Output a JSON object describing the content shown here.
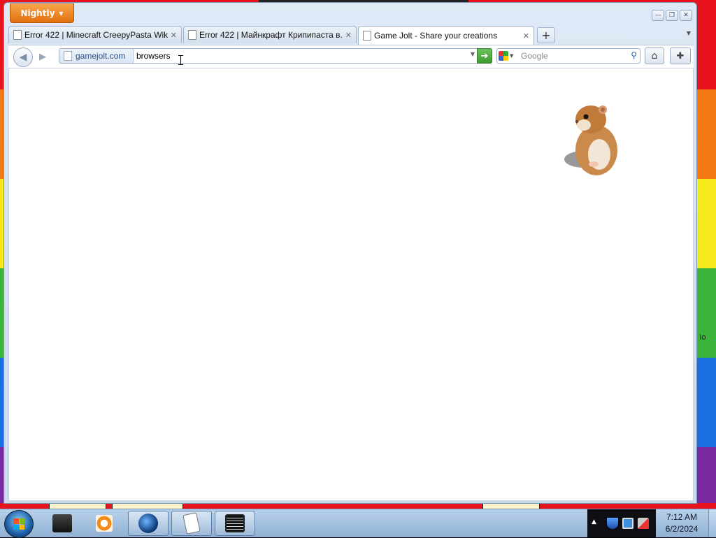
{
  "app": {
    "menu_button_label": "Nightly"
  },
  "window_controls": {
    "minimize": "—",
    "restore": "❐",
    "close": "✕"
  },
  "tabs": [
    {
      "title": "Error 422 | Minecraft CreepyPasta Wik...",
      "active": false
    },
    {
      "title": "Error 422 | Майнкрафт Крипипаста в...",
      "active": false
    },
    {
      "title": "Game Jolt - Share your creations",
      "active": true
    }
  ],
  "tab_close_glyph": "✕",
  "new_tab_glyph": "+",
  "toolbar": {
    "back_glyph": "◀",
    "forward_glyph": "▶",
    "site_identity": "gamejolt.com",
    "url_value": "browsers",
    "go_glyph": "➔",
    "search_placeholder": "Google",
    "search_glyph": "⚲",
    "home_glyph": "⌂",
    "addon_glyph": "✚"
  },
  "desktop": {
    "side_text": "io"
  },
  "taskbar": {
    "items": [
      {
        "icon": "dark-folder-icon",
        "open": false
      },
      {
        "icon": "media-player-icon",
        "open": false
      },
      {
        "icon": "globe-browser-icon",
        "open": true
      },
      {
        "icon": "solitaire-cards-icon",
        "open": true
      },
      {
        "icon": "terminal-list-icon",
        "open": true
      }
    ],
    "clock_time": "7:12 AM",
    "clock_date": "6/2/2024",
    "tray_overflow_glyph": "▲"
  },
  "colors": {
    "app_button": "#e3710f",
    "go_button": "#3e9a31",
    "taskbar": "#8fb0d3"
  }
}
